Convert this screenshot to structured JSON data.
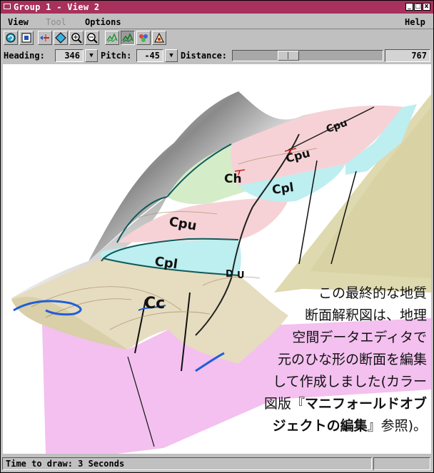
{
  "window": {
    "title": "Group 1 - View 2"
  },
  "window_controls": [
    "minimize-icon",
    "maximize-icon",
    "close-icon"
  ],
  "menubar": {
    "view": "View",
    "tool": "Tool",
    "options": "Options",
    "help": "Help"
  },
  "toolbar": {
    "icons": [
      "redraw-icon",
      "full-view-icon",
      "add-layer-icon",
      "pan-icon",
      "zoom-in-icon",
      "zoom-out-icon",
      "contour-icon",
      "terrain-icon",
      "color-palette-icon",
      "viewer-icon"
    ],
    "selected": "terrain-icon"
  },
  "viewbar": {
    "heading_label": "Heading:",
    "heading_value": "346",
    "pitch_label": "Pitch:",
    "pitch_value": "-45",
    "distance_label": "Distance:",
    "distance_value": "767",
    "distance_slider_fraction": 0.35
  },
  "map_labels": [
    "Cpu",
    "Cpu",
    "Ch",
    "Cpl",
    "Cpu",
    "Cpl",
    "Cc",
    "D",
    "U"
  ],
  "caption": {
    "line1": "この最終的な地質",
    "line2": "断面解釈図は、地理",
    "line3": "空間データエディタで",
    "line4": "元のひな形の断面を編集",
    "line5": "して作成しました(カラー",
    "line6_pre": "図版『",
    "line6_bold": "マニフォールドオブ",
    "line7_bold": "ジェクトの編集",
    "line7_post": "』参照)。"
  },
  "status": {
    "text": "Time to draw: 3 Seconds"
  },
  "colors": {
    "titlebar": "#a8305c",
    "unit_cpu": "#f6d2d6",
    "unit_cpl": "#bdeef0",
    "unit_ch": "#d5ecc8",
    "unit_cc": "#e6dcc0",
    "cross_section": "#f3c0ef",
    "stream": "#1f5ed8"
  }
}
